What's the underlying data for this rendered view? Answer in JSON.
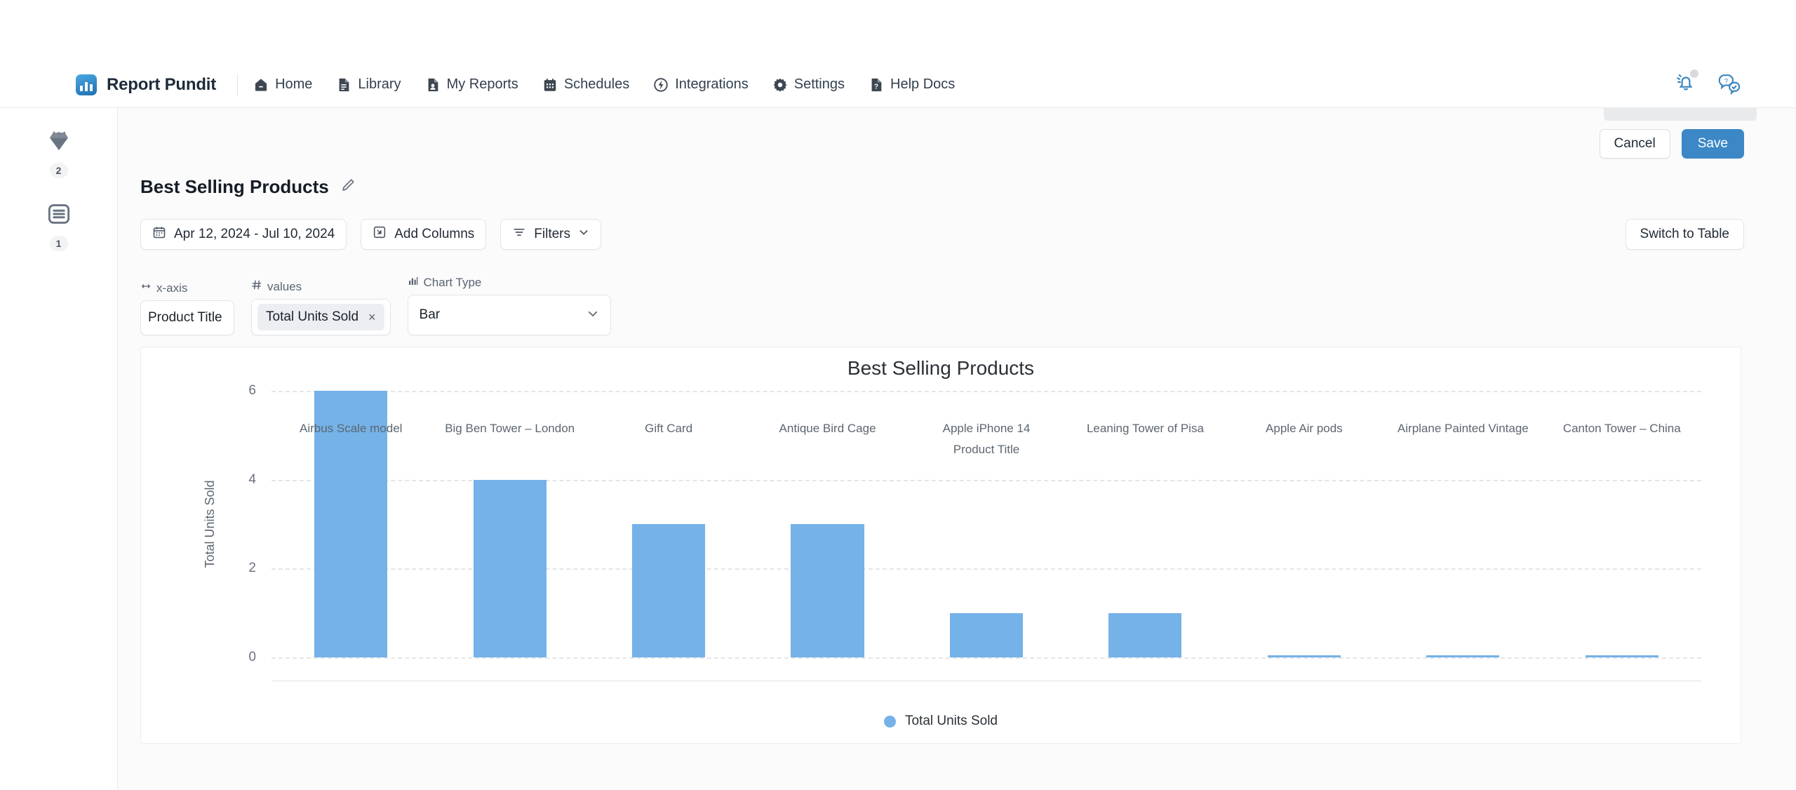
{
  "app": {
    "brand": "Report Pundit"
  },
  "nav": {
    "items": [
      {
        "label": "Home",
        "icon": "home-icon"
      },
      {
        "label": "Library",
        "icon": "library-icon"
      },
      {
        "label": "My Reports",
        "icon": "my-reports-icon"
      },
      {
        "label": "Schedules",
        "icon": "schedules-icon"
      },
      {
        "label": "Integrations",
        "icon": "integrations-icon"
      },
      {
        "label": "Settings",
        "icon": "gear-icon"
      },
      {
        "label": "Help Docs",
        "icon": "help-docs-icon"
      }
    ],
    "notifications_icon": "bell-icon",
    "support_icon": "chat-help-icon"
  },
  "rail": {
    "items": [
      {
        "icon": "diamond-icon",
        "badge": "2"
      },
      {
        "icon": "list-icon",
        "badge": "1"
      }
    ]
  },
  "actions": {
    "cancel_label": "Cancel",
    "save_label": "Save"
  },
  "report": {
    "title": "Best Selling Products",
    "edit_icon": "pencil-icon"
  },
  "controls": {
    "date_range": "Apr 12, 2024 - Jul 10, 2024",
    "date_icon": "calendar-icon",
    "add_columns": "Add Columns",
    "add_columns_icon": "add-columns-icon",
    "filters": "Filters",
    "filters_icon": "filter-icon",
    "filters_caret": "chevron-down-icon",
    "switch_to_table": "Switch to Table"
  },
  "fields": {
    "xaxis": {
      "label": "x-axis",
      "icon": "arrows-horizontal-icon",
      "value": "Product Title"
    },
    "values": {
      "label": "values",
      "icon": "hash-icon",
      "token": "Total Units Sold",
      "remove_icon": "close-icon"
    },
    "chart_type": {
      "label": "Chart Type",
      "icon": "chart-icon",
      "value": "Bar",
      "caret": "chevron-down-icon"
    }
  },
  "colors": {
    "bar": "#74b2e8",
    "accent": "#3c88c6",
    "grid": "#e3e5e8"
  },
  "chart_data": {
    "type": "bar",
    "title": "Best Selling Products",
    "xlabel": "Product Title",
    "ylabel": "Total Units Sold",
    "ylim": [
      0,
      6
    ],
    "yticks": [
      0,
      2,
      4,
      6
    ],
    "grid": true,
    "legend_position": "bottom",
    "legend": [
      "Total Units Sold"
    ],
    "categories": [
      "Airbus Scale model",
      "Big Ben Tower – London",
      "Gift Card",
      "Antique Bird Cage",
      "Apple iPhone 14",
      "Leaning Tower of Pisa",
      "Apple Air pods",
      "Airplane Painted Vintage",
      "Canton Tower – China"
    ],
    "series": [
      {
        "name": "Total Units Sold",
        "values": [
          6,
          4,
          3,
          3,
          1,
          1,
          0.05,
          0.05,
          0.05
        ]
      }
    ]
  }
}
